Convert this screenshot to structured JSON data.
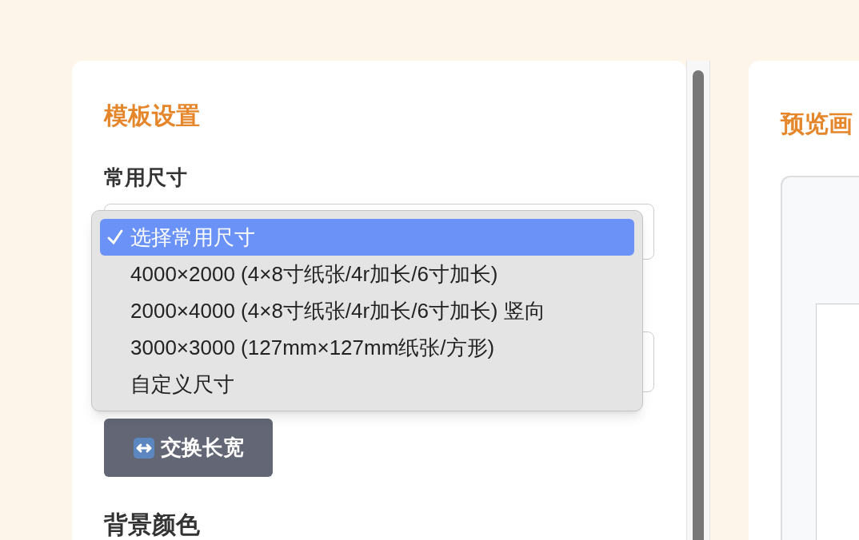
{
  "settings_panel": {
    "title": "模板设置",
    "size_label": "常用尺寸",
    "size_options": [
      {
        "label": "选择常用尺寸",
        "selected": true
      },
      {
        "label": "4000×2000 (4×8寸纸张/4r加长/6寸加长)",
        "selected": false
      },
      {
        "label": "2000×4000 (4×8寸纸张/4r加长/6寸加长) 竖向",
        "selected": false
      },
      {
        "label": "3000×3000 (127mm×127mm纸张/方形)",
        "selected": false
      },
      {
        "label": "自定义尺寸",
        "selected": false
      }
    ],
    "swap_button": "交换长宽",
    "background_label": "背景颜色"
  },
  "preview_panel": {
    "title": "预览画"
  }
}
